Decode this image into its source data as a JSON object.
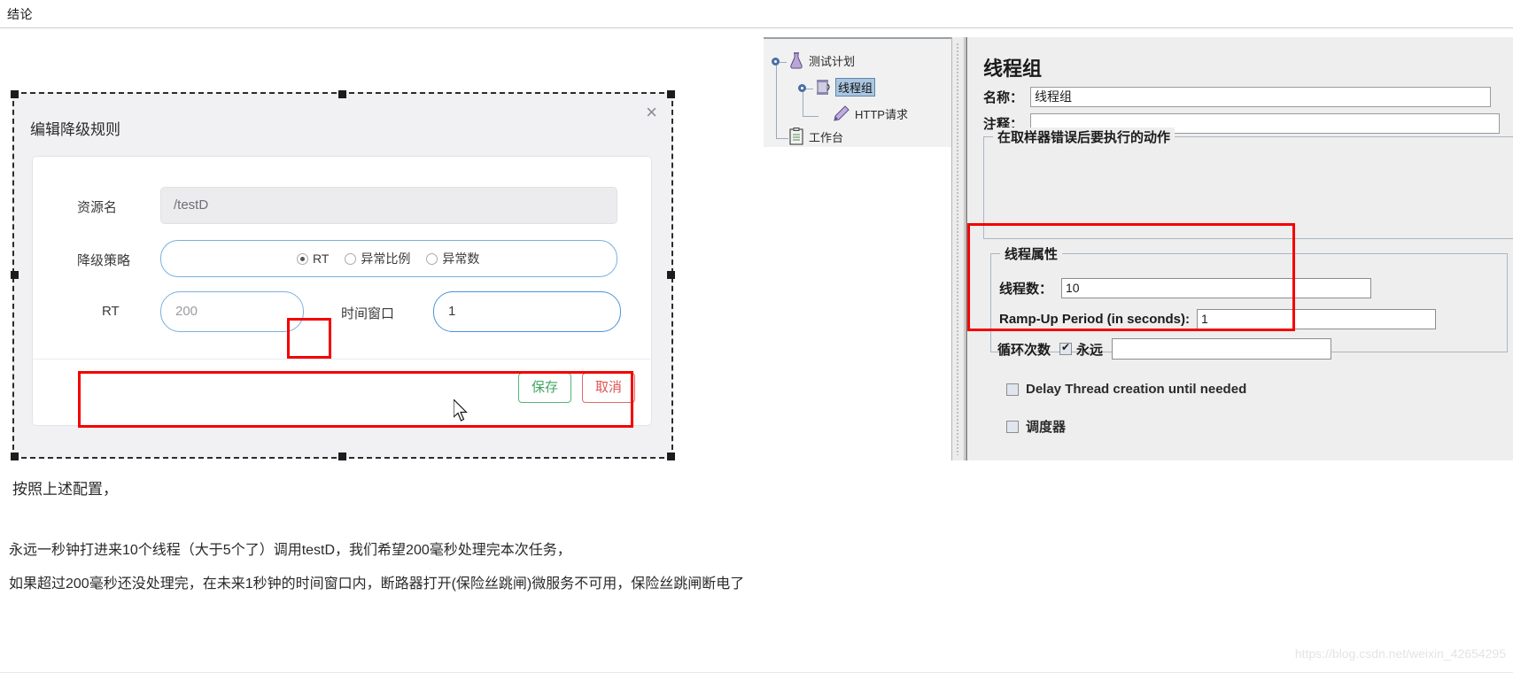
{
  "top_bar": {
    "heading": "结论"
  },
  "dialog": {
    "title": "编辑降级规则",
    "close_icon": "close-icon",
    "resource": {
      "label": "资源名",
      "value": "/testD"
    },
    "strategy": {
      "label": "降级策略",
      "options": [
        {
          "label": "RT",
          "checked": true
        },
        {
          "label": "异常比例",
          "checked": false
        },
        {
          "label": "异常数",
          "checked": false
        }
      ]
    },
    "rt": {
      "label": "RT",
      "value": "200"
    },
    "time_window": {
      "label": "时间窗口",
      "value": "1"
    },
    "buttons": {
      "save": "保存",
      "cancel": "取消"
    }
  },
  "jmeter_tree": {
    "nodes": [
      {
        "label": "测试计划",
        "icon": "flask-icon",
        "selected": false
      },
      {
        "label": "线程组",
        "icon": "thread-spool-icon",
        "selected": true
      },
      {
        "label": "HTTP请求",
        "icon": "pen-icon",
        "selected": false
      },
      {
        "label": "工作台",
        "icon": "clipboard-icon",
        "selected": false
      }
    ]
  },
  "jmeter_panel": {
    "title": "线程组",
    "name": {
      "label": "名称：",
      "value": "线程组"
    },
    "comment": {
      "label": "注释：",
      "value": ""
    },
    "sampler_error_group": {
      "title": "在取样器错误后要执行的动作"
    },
    "thread_properties": {
      "title": "线程属性",
      "thread_count": {
        "label": "线程数：",
        "value": "10"
      },
      "ramp_up": {
        "label": "Ramp-Up Period (in seconds):",
        "value": "1"
      },
      "loop_count": {
        "label": "循环次数",
        "forever_label": "永远",
        "forever_checked": true,
        "value": ""
      }
    },
    "delay_thread": {
      "label": "Delay Thread creation until needed",
      "checked": false
    },
    "scheduler": {
      "label": "调度器",
      "checked": false
    }
  },
  "paragraphs": {
    "p1": "按照上述配置，",
    "p2": "永远一秒钟打进来10个线程（大于5个了）调用testD，我们希望200毫秒处理完本次任务，",
    "p3": "如果超过200毫秒还没处理完，在未来1秒钟的时间窗口内，断路器打开(保险丝跳闸)微服务不可用，保险丝跳闸断电了"
  },
  "watermark": "https://blog.csdn.net/weixin_42654295",
  "colors": {
    "annotation_red": "#f40000",
    "save_green": "#3fa75f",
    "cancel_red": "#de5454",
    "input_blue": "#4a93d6"
  }
}
